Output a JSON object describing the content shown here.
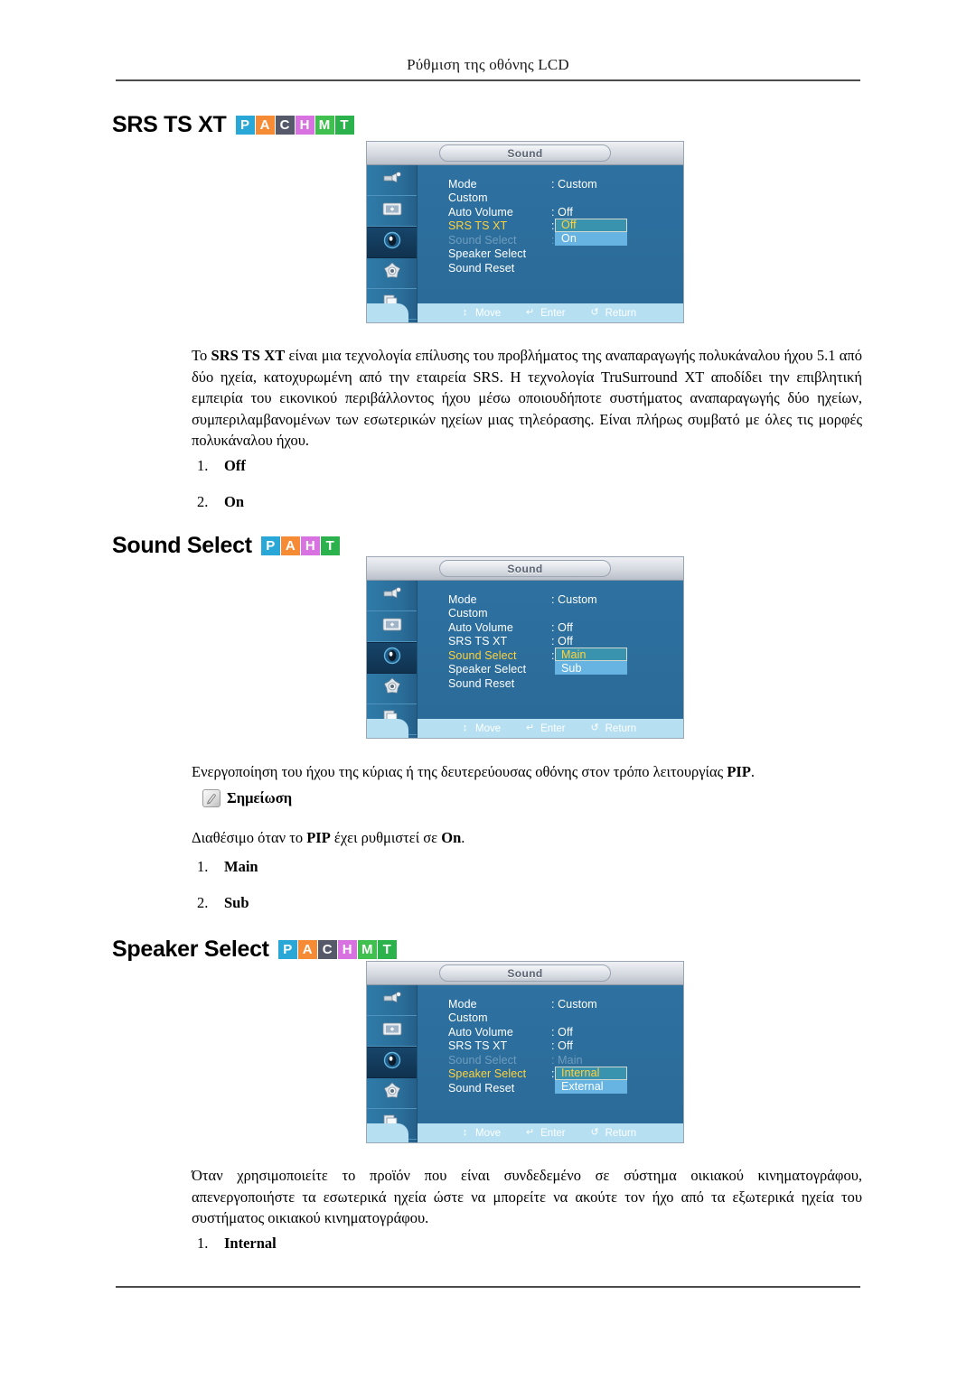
{
  "header": {
    "title": "Ρύθμιση της οθόνης LCD"
  },
  "badge_colors": {
    "P": "#29a8d8",
    "A": "#f58b34",
    "C": "#55596a",
    "H": "#d772e0",
    "M": "#3fc04f",
    "T": "#2bb24c"
  },
  "osd_common": {
    "title": "Sound",
    "footer": {
      "move": "Move",
      "enter": "Enter",
      "return": "Return",
      "move_icon": "up-down-arrow-icon",
      "enter_icon": "enter-key-icon",
      "return_icon": "return-arrow-icon"
    },
    "sidebar_icons": [
      "input-source-icon",
      "picture-icon",
      "sound-icon",
      "setup-gear-icon",
      "multi-control-icon"
    ]
  },
  "sections": [
    {
      "id": "srs-ts-xt",
      "heading": "SRS TS XT",
      "badges": [
        "P",
        "A",
        "C",
        "H",
        "M",
        "T"
      ],
      "osd": {
        "rows": [
          {
            "label": "Mode",
            "value": ": Custom",
            "state": "normal"
          },
          {
            "label": "Custom",
            "value": "",
            "state": "normal"
          },
          {
            "label": "Auto Volume",
            "value": ": Off",
            "state": "normal"
          },
          {
            "label": "SRS TS XT",
            "value": ":",
            "state": "active"
          },
          {
            "label": "Sound Select",
            "value": ":",
            "state": "dim"
          },
          {
            "label": "Speaker Select",
            "value": "",
            "state": "normal"
          },
          {
            "label": "Sound Reset",
            "value": "",
            "state": "normal"
          }
        ],
        "dropdown": {
          "top_row": 3,
          "selected": "Off",
          "unselected": "On"
        }
      },
      "paragraph_html": "Το <b>SRS TS XT</b> είναι μια τεχνολογία επίλυσης του προβλήματος της αναπαραγωγής πολυκάναλου ήχου 5.1 από δύο ηχεία, κατοχυρωμένη από την εταιρεία SRS. Η τεχνολογία TruSurround XT αποδίδει την επιβλητική εμπειρία του εικονικού περιβάλλοντος ήχου μέσω οποιουδήποτε συστήματος αναπαραγωγής δύο ηχείων, συμπεριλαμβανομένων των εσωτερικών ηχείων μιας τηλεόρασης. Είναι πλήρως συμβατό με όλες τις μορφές πολυκάναλου ήχου.",
      "list": [
        {
          "num": "1.",
          "text": "Off"
        },
        {
          "num": "2.",
          "text": "On"
        }
      ]
    },
    {
      "id": "sound-select",
      "heading": "Sound Select",
      "badges": [
        "P",
        "A",
        "H",
        "T"
      ],
      "osd": {
        "rows": [
          {
            "label": "Mode",
            "value": ": Custom",
            "state": "normal"
          },
          {
            "label": "Custom",
            "value": "",
            "state": "normal"
          },
          {
            "label": "Auto Volume",
            "value": ": Off",
            "state": "normal"
          },
          {
            "label": "SRS TS XT",
            "value": ": Off",
            "state": "normal"
          },
          {
            "label": "Sound Select",
            "value": ":",
            "state": "active"
          },
          {
            "label": "Speaker Select",
            "value": "",
            "state": "normal"
          },
          {
            "label": "Sound Reset",
            "value": "",
            "state": "normal"
          }
        ],
        "dropdown": {
          "top_row": 4,
          "selected": "Main",
          "unselected": "Sub"
        }
      },
      "paragraph_html": "Ενεργοποίηση του ήχου της κύριας ή της δευτερεύουσας οθόνης στον τρόπο λειτουργίας <b>PIP</b>.",
      "note_label": "Σημείωση",
      "note_body_html": "Διαθέσιμο όταν το <b>PIP</b> έχει ρυθμιστεί σε <b>On</b>.",
      "list": [
        {
          "num": "1.",
          "text": "Main"
        },
        {
          "num": "2.",
          "text": "Sub"
        }
      ]
    },
    {
      "id": "speaker-select",
      "heading": "Speaker Select",
      "badges": [
        "P",
        "A",
        "C",
        "H",
        "M",
        "T"
      ],
      "osd": {
        "rows": [
          {
            "label": "Mode",
            "value": ": Custom",
            "state": "normal"
          },
          {
            "label": "Custom",
            "value": "",
            "state": "normal"
          },
          {
            "label": "Auto Volume",
            "value": ": Off",
            "state": "normal"
          },
          {
            "label": "SRS TS XT",
            "value": ": Off",
            "state": "normal"
          },
          {
            "label": "Sound Select",
            "value": ": Main",
            "state": "dim"
          },
          {
            "label": "Speaker Select",
            "value": ":",
            "state": "active"
          },
          {
            "label": "Sound Reset",
            "value": "",
            "state": "normal"
          }
        ],
        "dropdown": {
          "top_row": 5,
          "selected": "Internal",
          "unselected": "External"
        }
      },
      "paragraph_html": "Όταν χρησιμοποιείτε το προϊόν που είναι συνδεδεμένο σε σύστημα οικιακού κινηματογράφου, απενεργοποιήστε τα εσωτερικά ηχεία ώστε να μπορείτε να ακούτε τον ήχο από τα εξωτερικά ηχεία του συστήματος οικιακού κινηματογράφου.",
      "list": [
        {
          "num": "1.",
          "text": "Internal"
        }
      ]
    }
  ]
}
